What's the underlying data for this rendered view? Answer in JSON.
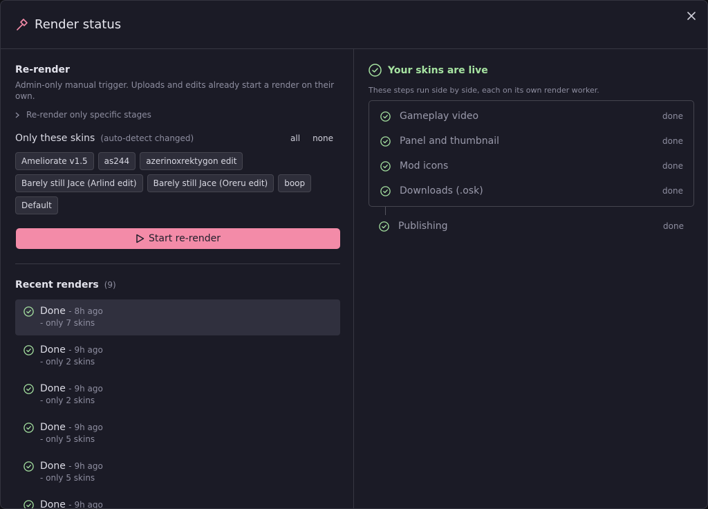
{
  "header": {
    "title": "Render status"
  },
  "rerender": {
    "title": "Re-render",
    "description": "Admin-only manual trigger. Uploads and edits already start a render on their own.",
    "expander_label": "Re-render only specific stages",
    "skins_label": "Only these skins",
    "skins_hint": "(auto-detect changed)",
    "all_label": "all",
    "none_label": "none",
    "skins": [
      "Ameliorate v1.5",
      "as244",
      "azerinoxrektygon edit",
      "Barely still Jace (Arlind edit)",
      "Barely still Jace (Oreru edit)",
      "boop",
      "Default"
    ],
    "start_label": "Start re-render"
  },
  "recent": {
    "title": "Recent renders",
    "count": "(9)",
    "items": [
      {
        "status": "Done",
        "ago": "- 8h ago",
        "detail": "- only 7 skins",
        "active": true
      },
      {
        "status": "Done",
        "ago": "- 9h ago",
        "detail": "- only 2 skins"
      },
      {
        "status": "Done",
        "ago": "- 9h ago",
        "detail": "- only 2 skins"
      },
      {
        "status": "Done",
        "ago": "- 9h ago",
        "detail": "- only 5 skins"
      },
      {
        "status": "Done",
        "ago": "- 9h ago",
        "detail": "- only 5 skins"
      },
      {
        "status": "Done",
        "ago": "- 9h ago",
        "detail": ""
      }
    ]
  },
  "live": {
    "title": "Your skins are live",
    "description": "These steps run side by side, each on its own render worker.",
    "steps": [
      {
        "name": "Gameplay video",
        "status": "done"
      },
      {
        "name": "Panel and thumbnail",
        "status": "done"
      },
      {
        "name": "Mod icons",
        "status": "done"
      },
      {
        "name": "Downloads (.osk)",
        "status": "done"
      }
    ],
    "final_step": {
      "name": "Publishing",
      "status": "done"
    }
  },
  "colors": {
    "accent": "#f38ba8",
    "success": "#a6e3a1",
    "panel": "#1b1b26"
  },
  "icons": {
    "header": "hammer-icon",
    "close": "close-icon",
    "check": "check-circle-icon",
    "play": "play-icon",
    "chevron": "chevron-right-icon"
  }
}
